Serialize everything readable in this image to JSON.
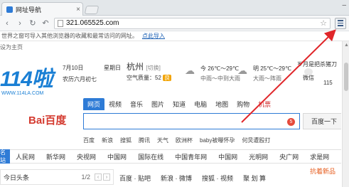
{
  "browser": {
    "tab_title": "网址导航",
    "tab_close": "×",
    "url": "321.065525.com",
    "import_text": "世界之窗可导入其他浏览器的收藏和最常访问的网址。",
    "import_link": "点此导入"
  },
  "page": {
    "set_home": "设为主页",
    "logo_text": "114啦",
    "logo_url": "WWW.114LA.COM",
    "date": "7月10日",
    "lunar": "农历六月初七",
    "weekday": "星期日",
    "city": "杭州",
    "switch": "[切换]",
    "air_label": "空气质量：52",
    "air_level": "良",
    "weather": [
      {
        "temp": "今 26℃～29℃",
        "desc": "中雨～中到大雨"
      },
      {
        "temp": "明 25℃～29℃",
        "desc": "大雨～阵雨"
      }
    ],
    "chance": "岁月是把杀猪刀",
    "wechat": "微信",
    "count": "115",
    "search_tabs": [
      "网页",
      "视频",
      "音乐",
      "图片",
      "知道",
      "电脑",
      "地图",
      "购物",
      "机票"
    ],
    "search_engine": "Bai百度",
    "search_badge": "5",
    "search_button": "百度一下",
    "quick_links": [
      "百度",
      "新浪",
      "搜狐",
      "腾讯",
      "天气",
      "欧洲杯",
      "baby被曝怀孕",
      "何炅遭殴打"
    ],
    "sites_lead": "名站",
    "sites": [
      "人民网",
      "新华网",
      "央视网",
      "中国网",
      "国际在线",
      "中国青年网",
      "中国网",
      "光明网",
      "央广网",
      "求是网"
    ],
    "news_title": "今日头条",
    "news_page": "1/2",
    "bottom_links": [
      "百度 · 贴吧",
      "新浪 · 微博",
      "搜狐 · 视频",
      "聚 划 算"
    ],
    "hot": "抗着新品"
  },
  "colors": {
    "accent": "#2e7bd6",
    "arrow": "#e0262a",
    "baidu_red": "#d43a2f"
  }
}
